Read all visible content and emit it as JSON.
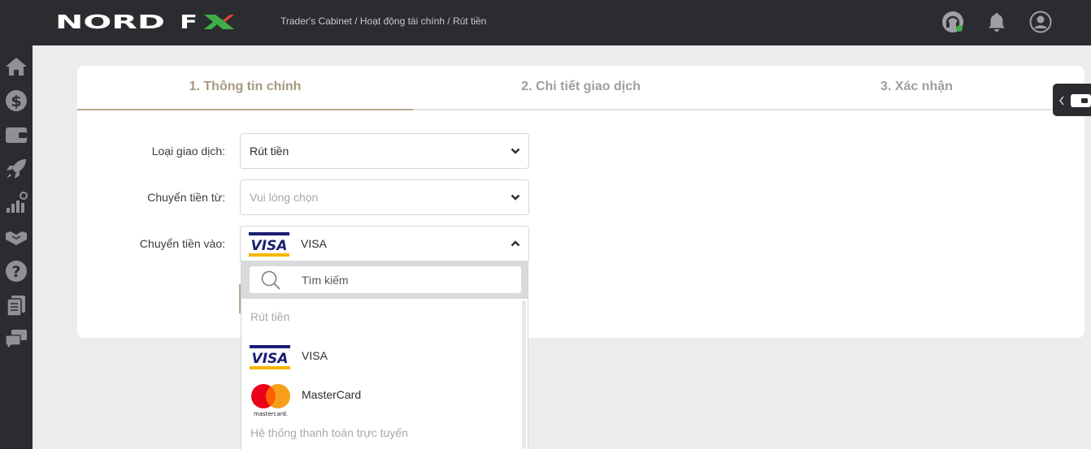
{
  "header": {
    "logo_text": "NORD FX",
    "breadcrumb": "Trader's Cabinet / Hoạt động tài chính / Rút tiền",
    "icons": [
      "support-headset-icon",
      "bell-icon",
      "user-icon"
    ]
  },
  "sidebar": {
    "items": [
      "home-icon",
      "dollar-icon",
      "wallet-icon",
      "rocket-icon",
      "chart-icon",
      "handshake-icon",
      "help-icon",
      "documents-icon",
      "chat-icon"
    ]
  },
  "steps": [
    {
      "label": "1. Thông tin chính",
      "active": true
    },
    {
      "label": "2. Chi tiết giao dịch",
      "active": false
    },
    {
      "label": "3. Xác nhận",
      "active": false
    }
  ],
  "form": {
    "transaction_type_label": "Loại giao dịch:",
    "transaction_type_value": "Rút tiền",
    "transfer_from_label": "Chuyển tiền từ:",
    "transfer_from_placeholder": "Vui lòng chọn",
    "transfer_to_label": "Chuyển tiền vào:",
    "transfer_to_value": "VISA"
  },
  "dropdown": {
    "search_placeholder": "Tìm kiếm",
    "group_withdraw": "Rút tiền",
    "options": [
      {
        "label": "VISA",
        "icon": "visa-logo"
      },
      {
        "label": "MasterCard",
        "icon": "mastercard-logo"
      }
    ],
    "group_online": "Hệ thống thanh toán trực tuyến"
  },
  "colors": {
    "dark_bar": "#2b2c30",
    "accent_gold": "#b7a98c",
    "page_bg": "#ececee",
    "logo_green": "#3fae49",
    "logo_red": "#e0403a"
  }
}
